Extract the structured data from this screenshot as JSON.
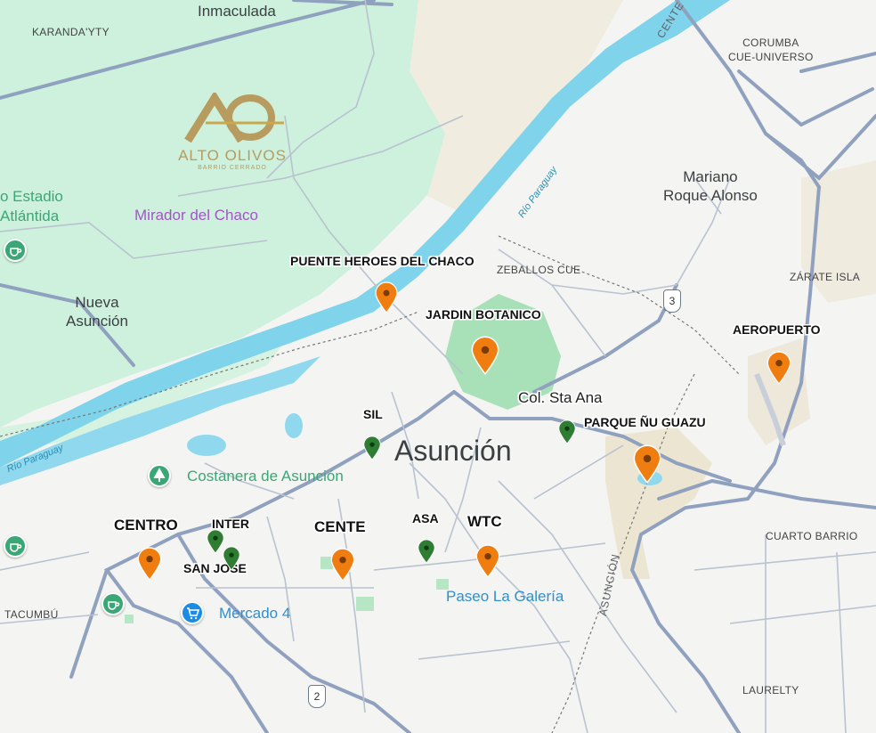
{
  "places": {
    "inmaculada": "Inmaculada",
    "karandayty": "KARANDA'YTY",
    "corumba": "CORUMBA\nCUE-UNIVERSO",
    "mariano": "Mariano\nRoque Alonso",
    "estadio": "o Estadio\nAtlántida",
    "mirador": "Mirador del Chaco",
    "nueva": "Nueva\nAsunción",
    "zeballos": "ZEBALLOS CUE",
    "zarate": "ZÁRATE ISLA",
    "asuncion": "Asunción",
    "costanera": "Costanera de Asunción",
    "mercado": "Mercado 4",
    "paseo": "Paseo La Galería",
    "tacumbu": "TACUMBÚ",
    "cuarto": "CUARTO BARRIO",
    "laurelty": "LAURELTY",
    "colstaana": "Col. Sta Ana"
  },
  "logo": {
    "line1": "ALTO OLIVOS",
    "line2": "BARRIO CERRADO"
  },
  "roads": {
    "route3": "3",
    "route2": "2",
    "asuncion_road": "ASUNCIÓN",
    "centenario": "CENTE"
  },
  "river": {
    "label1": "Río Paraguay",
    "label2": "Río Paraguay"
  },
  "pins": {
    "puente": "PUENTE HEROES DEL CHACO",
    "jardin": "JARDIN BOTANICO",
    "aeropuerto": "AEROPUERTO",
    "parque": "PARQUE ÑU GUAZU",
    "sil": "SIL",
    "centro": "CENTRO",
    "inter": "INTER",
    "sanjose": "SAN JOSE",
    "cente": "CENTE",
    "asa": "ASA",
    "wtc": "WTC"
  },
  "colors": {
    "orange_pin": "#ef7d0f",
    "green_pin": "#2e7d32",
    "river": "#7fd3eb",
    "park": "#c9f0d8",
    "road": "#8fa1bf"
  }
}
